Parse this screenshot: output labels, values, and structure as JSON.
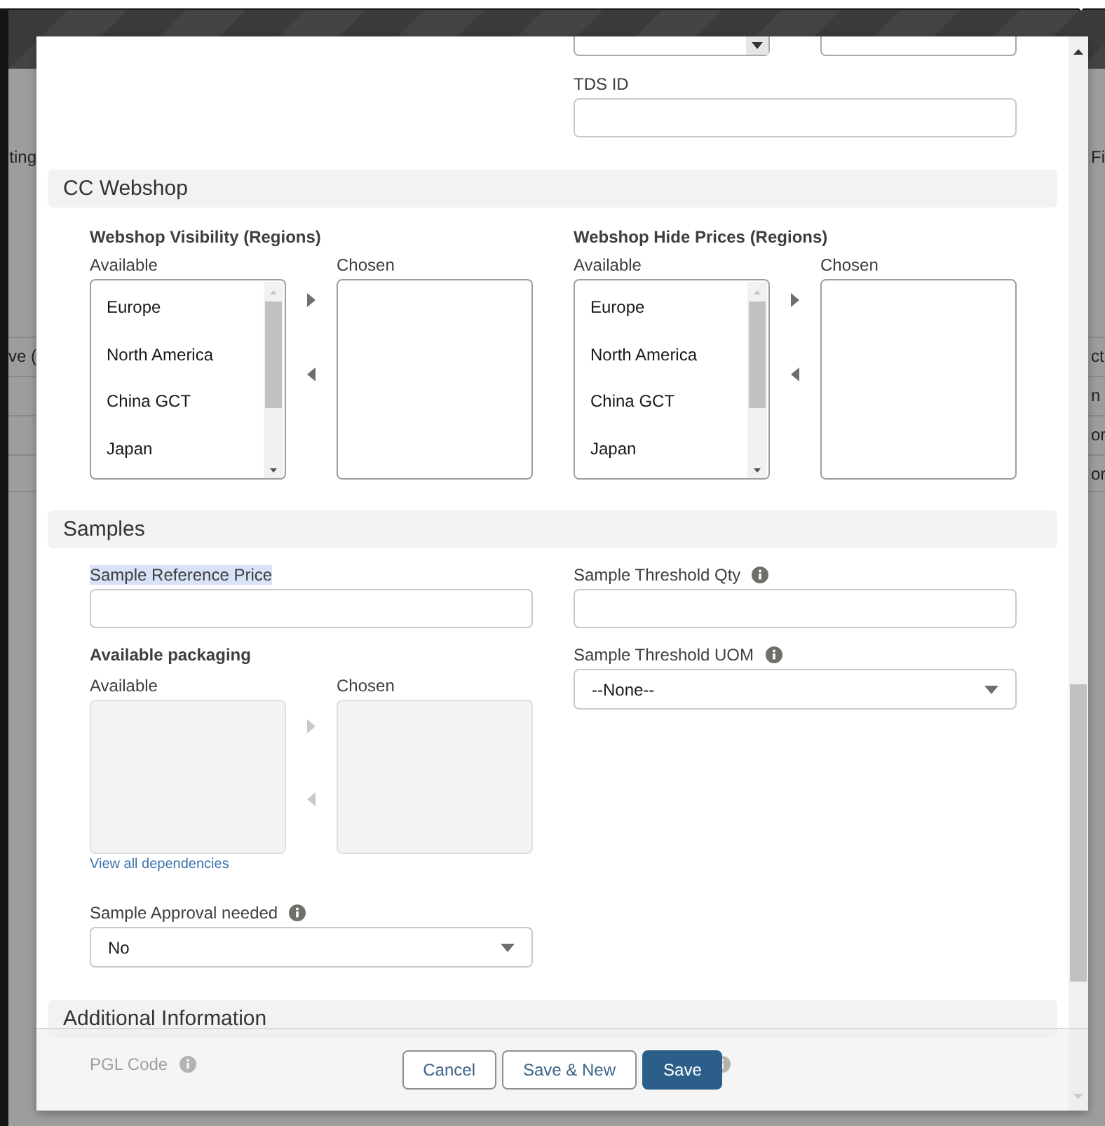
{
  "backdrop": {
    "left_fragments": [
      "ting",
      "ve ("
    ],
    "right_fragments": [
      "Fi",
      "ct",
      "n",
      "or",
      "or"
    ]
  },
  "top_fields": {
    "tds_id": {
      "label": "TDS ID",
      "kind": "text"
    }
  },
  "cc_webshop": {
    "title": "CC Webshop",
    "pickers": [
      {
        "title": "Webshop Visibility (Regions)",
        "available_label": "Available",
        "chosen_label": "Chosen",
        "options": [
          "Europe",
          "North America",
          "China GCT",
          "Japan"
        ],
        "disabled": false
      },
      {
        "title": "Webshop Hide Prices (Regions)",
        "available_label": "Available",
        "chosen_label": "Chosen",
        "options": [
          "Europe",
          "North America",
          "China GCT",
          "Japan"
        ],
        "disabled": false
      }
    ]
  },
  "samples": {
    "title": "Samples",
    "sample_reference_price": {
      "label": "Sample Reference Price",
      "kind": "text",
      "highlighted": true
    },
    "threshold_qty": {
      "label": "Sample Threshold Qty",
      "kind": "text",
      "info": true
    },
    "packaging": {
      "title": "Available packaging",
      "available_label": "Available",
      "chosen_label": "Chosen",
      "disabled": true
    },
    "threshold_uom": {
      "label": "Sample Threshold UOM",
      "kind": "picklist",
      "value": "--None--",
      "info": true
    },
    "dependencies_link": "View all dependencies",
    "sample_approval": {
      "label": "Sample Approval needed",
      "kind": "picklist",
      "value": "No",
      "info": true
    }
  },
  "additional_information": {
    "title": "Additional Information",
    "pgl_code": {
      "label": "PGL Code",
      "info": true
    }
  },
  "footer": {
    "buttons": [
      {
        "label": "Cancel",
        "kind": "neutral"
      },
      {
        "label": "Save & New",
        "kind": "neutral"
      },
      {
        "label": "Save",
        "kind": "brand"
      }
    ]
  }
}
